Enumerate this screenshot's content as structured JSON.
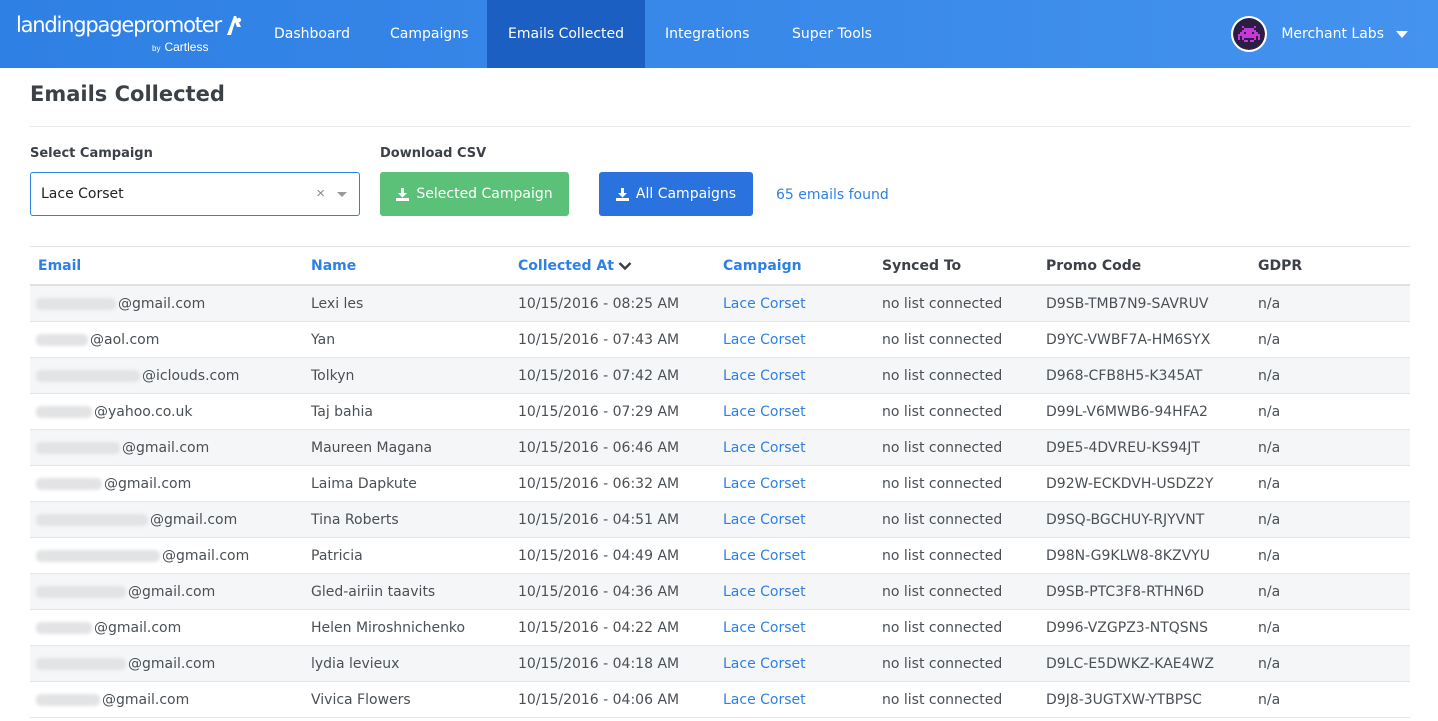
{
  "app": {
    "logo_text": "landingpagepromoter",
    "logo_by": "by",
    "logo_company": "Cartless"
  },
  "nav": {
    "items": [
      {
        "label": "Dashboard",
        "active": false
      },
      {
        "label": "Campaigns",
        "active": false
      },
      {
        "label": "Emails Collected",
        "active": true
      },
      {
        "label": "Integrations",
        "active": false
      },
      {
        "label": "Super Tools",
        "active": false
      }
    ],
    "user_name": "Merchant Labs"
  },
  "page": {
    "title": "Emails Collected",
    "select_label": "Select Campaign",
    "select_value": "Lace Corset",
    "select_clear": "×",
    "download_label": "Download CSV",
    "btn_selected": "Selected Campaign",
    "btn_all": "All Campaigns",
    "found_text": "65 emails found"
  },
  "table": {
    "columns": [
      "Email",
      "Name",
      "Collected At",
      "Campaign",
      "Synced To",
      "Promo Code",
      "GDPR"
    ],
    "rows": [
      {
        "email": "@gmail.com",
        "name": "Lexi les",
        "collected": "10/15/2016 - 08:25 AM",
        "campaign": "Lace Corset",
        "synced": "no list connected",
        "promo": "D9SB-TMB7N9-SAVRUV",
        "gdpr": "n/a"
      },
      {
        "email": "@aol.com",
        "name": "Yan",
        "collected": "10/15/2016 - 07:43 AM",
        "campaign": "Lace Corset",
        "synced": "no list connected",
        "promo": "D9YC-VWBF7A-HM6SYX",
        "gdpr": "n/a"
      },
      {
        "email": "@iclouds.com",
        "name": "Tolkyn",
        "collected": "10/15/2016 - 07:42 AM",
        "campaign": "Lace Corset",
        "synced": "no list connected",
        "promo": "D968-CFB8H5-K345AT",
        "gdpr": "n/a"
      },
      {
        "email": "@yahoo.co.uk",
        "name": "Taj bahia",
        "collected": "10/15/2016 - 07:29 AM",
        "campaign": "Lace Corset",
        "synced": "no list connected",
        "promo": "D99L-V6MWB6-94HFA2",
        "gdpr": "n/a"
      },
      {
        "email": "@gmail.com",
        "name": "Maureen Magana",
        "collected": "10/15/2016 - 06:46 AM",
        "campaign": "Lace Corset",
        "synced": "no list connected",
        "promo": "D9E5-4DVREU-KS94JT",
        "gdpr": "n/a"
      },
      {
        "email": "@gmail.com",
        "name": "Laima Dapkute",
        "collected": "10/15/2016 - 06:32 AM",
        "campaign": "Lace Corset",
        "synced": "no list connected",
        "promo": "D92W-ECKDVH-USDZ2Y",
        "gdpr": "n/a"
      },
      {
        "email": "@gmail.com",
        "name": "Tina Roberts",
        "collected": "10/15/2016 - 04:51 AM",
        "campaign": "Lace Corset",
        "synced": "no list connected",
        "promo": "D9SQ-BGCHUY-RJYVNT",
        "gdpr": "n/a"
      },
      {
        "email": "@gmail.com",
        "name": "Patricia",
        "collected": "10/15/2016 - 04:49 AM",
        "campaign": "Lace Corset",
        "synced": "no list connected",
        "promo": "D98N-G9KLW8-8KZVYU",
        "gdpr": "n/a"
      },
      {
        "email": "@gmail.com",
        "name": "Gled-airiin taavits",
        "collected": "10/15/2016 - 04:36 AM",
        "campaign": "Lace Corset",
        "synced": "no list connected",
        "promo": "D9SB-PTC3F8-RTHN6D",
        "gdpr": "n/a"
      },
      {
        "email": "@gmail.com",
        "name": "Helen Miroshnichenko",
        "collected": "10/15/2016 - 04:22 AM",
        "campaign": "Lace Corset",
        "synced": "no list connected",
        "promo": "D996-VZGPZ3-NTQSNS",
        "gdpr": "n/a"
      },
      {
        "email": "@gmail.com",
        "name": "lydia levieux",
        "collected": "10/15/2016 - 04:18 AM",
        "campaign": "Lace Corset",
        "synced": "no list connected",
        "promo": "D9LC-E5DWKZ-KAE4WZ",
        "gdpr": "n/a"
      },
      {
        "email": "@gmail.com",
        "name": "Vivica Flowers",
        "collected": "10/15/2016 - 04:06 AM",
        "campaign": "Lace Corset",
        "synced": "no list connected",
        "promo": "D9J8-3UGTXW-YTBPSC",
        "gdpr": "n/a"
      }
    ]
  },
  "colors": {
    "nav_bg": "#2f80e4",
    "nav_active": "#1c5fc2",
    "link": "#2f80e4",
    "btn_green": "#5cc178",
    "btn_blue": "#2a72de"
  }
}
